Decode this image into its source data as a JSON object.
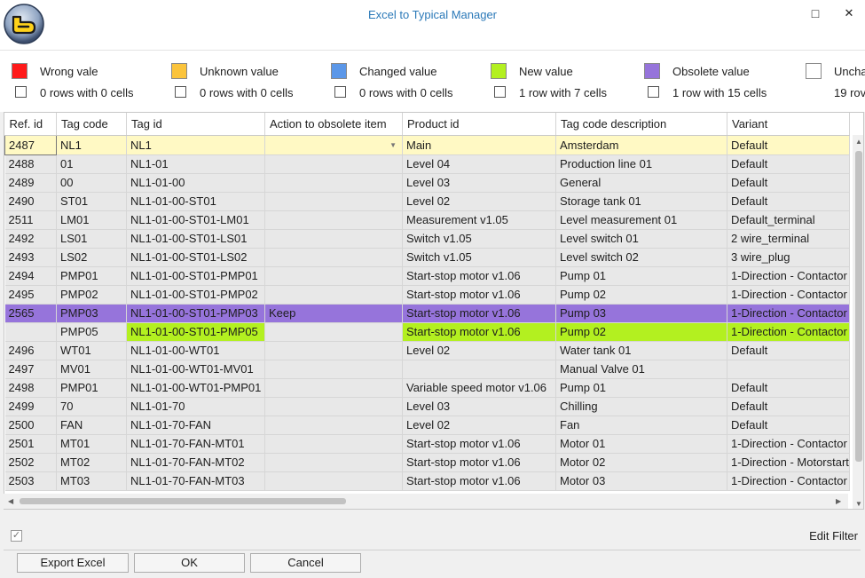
{
  "window": {
    "title": "Excel to Typical Manager",
    "maximize_glyph": "□",
    "close_glyph": "✕"
  },
  "legend": [
    {
      "label": "Wrong vale",
      "color": "#ff1a1a",
      "count_text": "0 rows with 0 cells",
      "checked": false
    },
    {
      "label": "Unknown value",
      "color": "#fbc43c",
      "count_text": "0 rows with 0 cells",
      "checked": false
    },
    {
      "label": "Changed value",
      "color": "#5b97e8",
      "count_text": "0 rows with 0 cells",
      "checked": false
    },
    {
      "label": "New value",
      "color": "#b3f020",
      "count_text": "1 row with 7 cells",
      "checked": false
    },
    {
      "label": "Obsolete value",
      "color": "#9674db",
      "count_text": "1 row with 15 cells",
      "checked": false
    },
    {
      "label": "Uncha",
      "color": "#ffffff",
      "count_text": "19 rov",
      "checked": false
    }
  ],
  "grid": {
    "columns": [
      "Ref. id",
      "Tag code",
      "Tag id",
      "Action to obsolete item",
      "Product id",
      "Tag code description",
      "Variant"
    ],
    "rows": [
      {
        "state": "current",
        "cells": [
          "2487",
          "NL1",
          "NL1",
          "",
          "Main",
          "Amsterdam",
          "Default"
        ]
      },
      {
        "state": "normal",
        "cells": [
          "2488",
          "01",
          "NL1-01",
          "",
          "Level 04",
          "Production line 01",
          "Default"
        ]
      },
      {
        "state": "normal",
        "cells": [
          "2489",
          "00",
          "NL1-01-00",
          "",
          "Level 03",
          "General",
          "Default"
        ]
      },
      {
        "state": "normal",
        "cells": [
          "2490",
          "ST01",
          "NL1-01-00-ST01",
          "",
          "Level 02",
          "Storage tank 01",
          "Default"
        ]
      },
      {
        "state": "normal",
        "cells": [
          "2511",
          "LM01",
          "NL1-01-00-ST01-LM01",
          "",
          "Measurement v1.05",
          "Level measurement 01",
          "Default_terminal"
        ]
      },
      {
        "state": "normal",
        "cells": [
          "2492",
          "LS01",
          "NL1-01-00-ST01-LS01",
          "",
          "Switch v1.05",
          "Level switch 01",
          "2 wire_terminal"
        ]
      },
      {
        "state": "normal",
        "cells": [
          "2493",
          "LS02",
          "NL1-01-00-ST01-LS02",
          "",
          "Switch v1.05",
          "Level switch 02",
          "3 wire_plug"
        ]
      },
      {
        "state": "normal",
        "cells": [
          "2494",
          "PMP01",
          "NL1-01-00-ST01-PMP01",
          "",
          "Start-stop motor v1.06",
          "Pump 01",
          "1-Direction - Contactor"
        ]
      },
      {
        "state": "normal",
        "cells": [
          "2495",
          "PMP02",
          "NL1-01-00-ST01-PMP02",
          "",
          "Start-stop motor v1.06",
          "Pump 02",
          "1-Direction - Contactor"
        ]
      },
      {
        "state": "obsolete",
        "cells": [
          "2565",
          "PMP03",
          "NL1-01-00-ST01-PMP03",
          "Keep",
          "Start-stop motor v1.06",
          "Pump 03",
          "1-Direction - Contactor"
        ]
      },
      {
        "state": "new",
        "cells": [
          "",
          "PMP05",
          "NL1-01-00-ST01-PMP05",
          "",
          "Start-stop motor v1.06",
          "Pump 02",
          "1-Direction - Contactor"
        ],
        "new_cells": [
          2,
          4,
          5,
          6
        ]
      },
      {
        "state": "normal",
        "cells": [
          "2496",
          "WT01",
          "NL1-01-00-WT01",
          "",
          "Level 02",
          "Water tank 01",
          "Default"
        ]
      },
      {
        "state": "normal",
        "cells": [
          "2497",
          "MV01",
          "NL1-01-00-WT01-MV01",
          "",
          "",
          "Manual Valve 01",
          ""
        ]
      },
      {
        "state": "normal",
        "cells": [
          "2498",
          "PMP01",
          "NL1-01-00-WT01-PMP01",
          "",
          "Variable speed motor v1.06",
          "Pump 01",
          "Default"
        ]
      },
      {
        "state": "normal",
        "cells": [
          "2499",
          "70",
          "NL1-01-70",
          "",
          "Level 03",
          "Chilling",
          "Default"
        ]
      },
      {
        "state": "normal",
        "cells": [
          "2500",
          "FAN",
          "NL1-01-70-FAN",
          "",
          "Level 02",
          "Fan",
          "Default"
        ]
      },
      {
        "state": "normal",
        "cells": [
          "2501",
          "MT01",
          "NL1-01-70-FAN-MT01",
          "",
          "Start-stop motor v1.06",
          "Motor 01",
          "1-Direction - Contactor"
        ]
      },
      {
        "state": "normal",
        "cells": [
          "2502",
          "MT02",
          "NL1-01-70-FAN-MT02",
          "",
          "Start-stop motor v1.06",
          "Motor 02",
          "1-Direction - Motorstart"
        ]
      },
      {
        "state": "normal",
        "cells": [
          "2503",
          "MT03",
          "NL1-01-70-FAN-MT03",
          "",
          "Start-stop motor v1.06",
          "Motor 03",
          "1-Direction - Contactor"
        ]
      }
    ]
  },
  "footer": {
    "filter_checked": true,
    "edit_filter_label": "Edit Filter"
  },
  "buttons": {
    "export": "Export Excel",
    "ok": "OK",
    "cancel": "Cancel"
  }
}
